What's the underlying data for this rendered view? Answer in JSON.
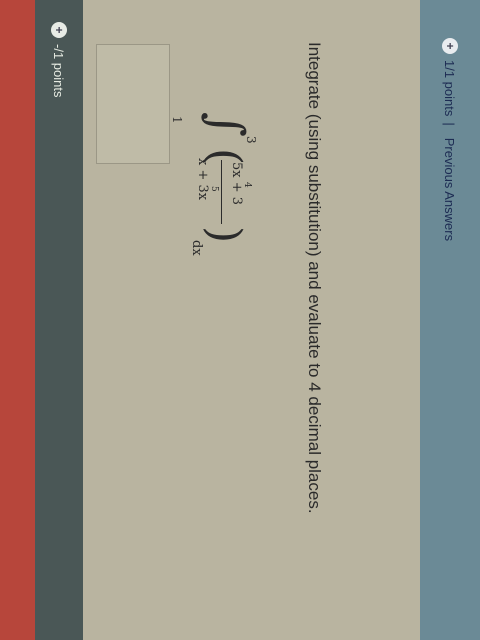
{
  "header": {
    "points": "-/1 points"
  },
  "question": {
    "prompt": "Integrate (using substitution) and evaluate to 4 decimal places.",
    "integral": {
      "upper": "3",
      "lower": "1",
      "numerator": "5x + 3",
      "numerator_exponent": "4",
      "denominator": "x + 3x",
      "denominator_exponent": "5",
      "differential": "dx"
    }
  },
  "footer": {
    "points": "1/1 points",
    "separator": "|",
    "previous_answers": "Previous Answers"
  },
  "icons": {
    "header": "plus-circle-icon",
    "footer": "plus-circle-icon"
  },
  "colors": {
    "header_bar": "#4a5756",
    "panel": "#b9b4a0",
    "footer_strip": "#6b8a96",
    "footer_text": "#1d2c53",
    "edge_accent": "#b7463b"
  }
}
